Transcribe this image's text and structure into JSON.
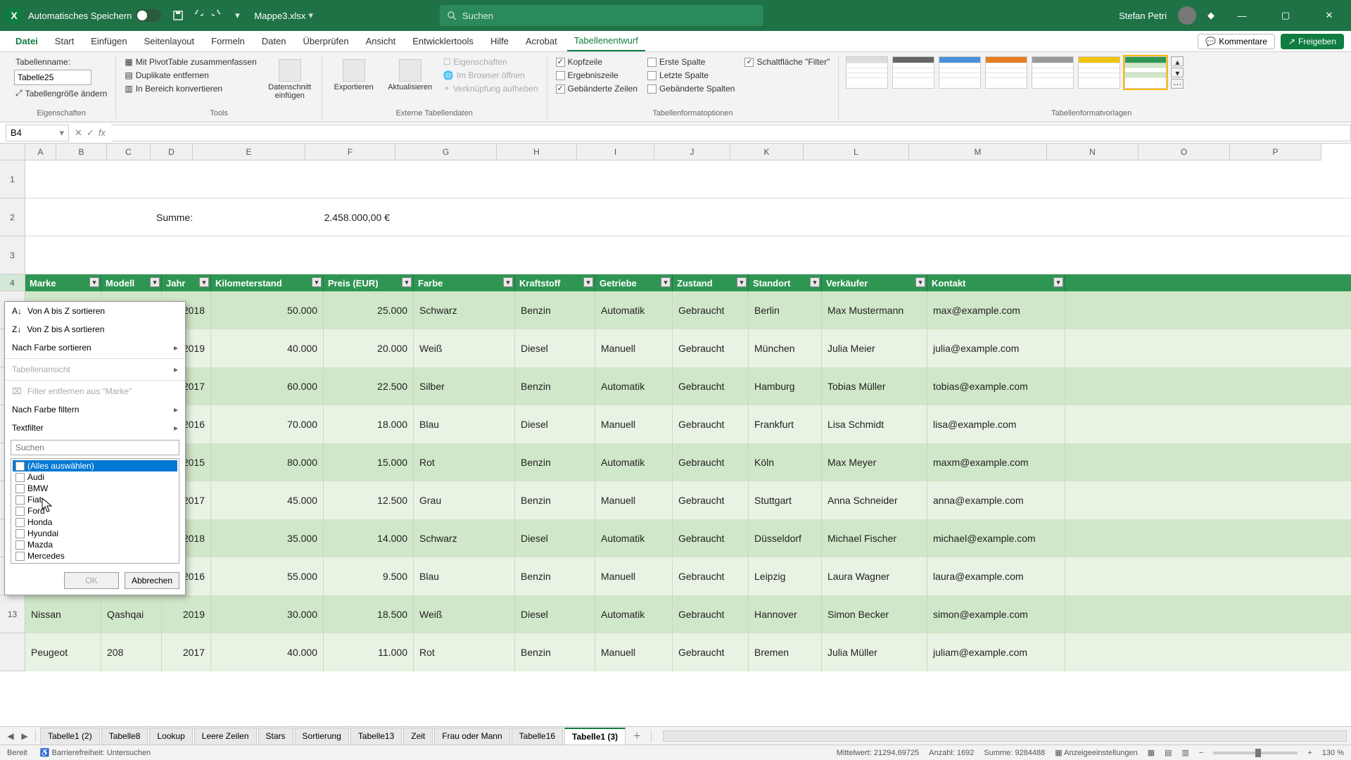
{
  "titlebar": {
    "autosave": "Automatisches Speichern",
    "filename": "Mappe3.xlsx",
    "search_placeholder": "Suchen",
    "username": "Stefan Petri"
  },
  "ribbon_tabs": [
    "Datei",
    "Start",
    "Einfügen",
    "Seitenlayout",
    "Formeln",
    "Daten",
    "Überprüfen",
    "Ansicht",
    "Entwicklertools",
    "Hilfe",
    "Acrobat",
    "Tabellenentwurf"
  ],
  "ribbon_active": "Tabellenentwurf",
  "ribbon_actions": {
    "comments": "Kommentare",
    "share": "Freigeben"
  },
  "ribbon": {
    "props": {
      "name_label": "Tabellenname:",
      "name_value": "Tabelle25",
      "resize": "Tabellengröße ändern",
      "group": "Eigenschaften"
    },
    "tools": {
      "pivot": "Mit PivotTable zusammenfassen",
      "dupes": "Duplikate entfernen",
      "range": "In Bereich konvertieren",
      "slicer": "Datenschnitt einfügen",
      "group": "Tools"
    },
    "ext": {
      "export": "Exportieren",
      "refresh": "Aktualisieren",
      "props": "Eigenschaften",
      "browser": "Im Browser öffnen",
      "unlink": "Verknüpfung aufheben",
      "group": "Externe Tabellendaten"
    },
    "opts": {
      "header": "Kopfzeile",
      "total": "Ergebniszeile",
      "banded_r": "Gebänderte Zeilen",
      "first": "Erste Spalte",
      "last": "Letzte Spalte",
      "banded_c": "Gebänderte Spalten",
      "filter": "Schaltfläche \"Filter\"",
      "group": "Tabellenformatoptionen"
    },
    "styles_group": "Tabellenformatvorlagen"
  },
  "name_box": "B4",
  "columns": [
    "A",
    "B",
    "C",
    "D",
    "E",
    "F",
    "G",
    "H",
    "I",
    "J",
    "K",
    "L",
    "M",
    "N",
    "O",
    "P"
  ],
  "sum_label": "Summe:",
  "sum_value": "2.458.000,00 €",
  "headers": [
    "Marke",
    "Modell",
    "Jahr",
    "Kilometerstand",
    "Preis (EUR)",
    "Farbe",
    "Kraftstoff",
    "Getriebe",
    "Zustand",
    "Standort",
    "Verkäufer",
    "Kontakt"
  ],
  "rows": [
    {
      "marke": "",
      "modell": "",
      "jahr": "2018",
      "km": "50.000",
      "preis": "25.000",
      "farbe": "Schwarz",
      "kraft": "Benzin",
      "getr": "Automatik",
      "zust": "Gebraucht",
      "ort": "Berlin",
      "verk": "Max Mustermann",
      "kontakt": "max@example.com"
    },
    {
      "marke": "",
      "modell": "",
      "jahr": "2019",
      "km": "40.000",
      "preis": "20.000",
      "farbe": "Weiß",
      "kraft": "Diesel",
      "getr": "Manuell",
      "zust": "Gebraucht",
      "ort": "München",
      "verk": "Julia Meier",
      "kontakt": "julia@example.com"
    },
    {
      "marke": "",
      "modell": "",
      "jahr": "2017",
      "km": "60.000",
      "preis": "22.500",
      "farbe": "Silber",
      "kraft": "Benzin",
      "getr": "Automatik",
      "zust": "Gebraucht",
      "ort": "Hamburg",
      "verk": "Tobias Müller",
      "kontakt": "tobias@example.com"
    },
    {
      "marke": "",
      "modell": "",
      "jahr": "2016",
      "km": "70.000",
      "preis": "18.000",
      "farbe": "Blau",
      "kraft": "Diesel",
      "getr": "Manuell",
      "zust": "Gebraucht",
      "ort": "Frankfurt",
      "verk": "Lisa Schmidt",
      "kontakt": "lisa@example.com"
    },
    {
      "marke": "",
      "modell": "",
      "jahr": "2015",
      "km": "80.000",
      "preis": "15.000",
      "farbe": "Rot",
      "kraft": "Benzin",
      "getr": "Automatik",
      "zust": "Gebraucht",
      "ort": "Köln",
      "verk": "Max Meyer",
      "kontakt": "maxm@example.com"
    },
    {
      "marke": "",
      "modell": "",
      "jahr": "2017",
      "km": "45.000",
      "preis": "12.500",
      "farbe": "Grau",
      "kraft": "Benzin",
      "getr": "Manuell",
      "zust": "Gebraucht",
      "ort": "Stuttgart",
      "verk": "Anna Schneider",
      "kontakt": "anna@example.com"
    },
    {
      "marke": "",
      "modell": "",
      "jahr": "2018",
      "km": "35.000",
      "preis": "14.000",
      "farbe": "Schwarz",
      "kraft": "Diesel",
      "getr": "Automatik",
      "zust": "Gebraucht",
      "ort": "Düsseldorf",
      "verk": "Michael Fischer",
      "kontakt": "michael@example.com"
    },
    {
      "marke": "",
      "modell": "",
      "jahr": "2016",
      "km": "55.000",
      "preis": "9.500",
      "farbe": "Blau",
      "kraft": "Benzin",
      "getr": "Manuell",
      "zust": "Gebraucht",
      "ort": "Leipzig",
      "verk": "Laura Wagner",
      "kontakt": "laura@example.com"
    },
    {
      "marke": "Nissan",
      "modell": "Qashqai",
      "jahr": "2019",
      "km": "30.000",
      "preis": "18.500",
      "farbe": "Weiß",
      "kraft": "Diesel",
      "getr": "Automatik",
      "zust": "Gebraucht",
      "ort": "Hannover",
      "verk": "Simon Becker",
      "kontakt": "simon@example.com"
    },
    {
      "marke": "Peugeot",
      "modell": "208",
      "jahr": "2017",
      "km": "40.000",
      "preis": "11.000",
      "farbe": "Rot",
      "kraft": "Benzin",
      "getr": "Manuell",
      "zust": "Gebraucht",
      "ort": "Bremen",
      "verk": "Julia Müller",
      "kontakt": "juliam@example.com"
    }
  ],
  "row_nums_visible": [
    "1",
    "2",
    "3",
    "4",
    "",
    "",
    "",
    "",
    "",
    "",
    "",
    "",
    "13",
    ""
  ],
  "filter": {
    "sort_az": "Von A bis Z sortieren",
    "sort_za": "Von Z bis A sortieren",
    "sort_color": "Nach Farbe sortieren",
    "sheet_view": "Tabellenansicht",
    "clear": "Filter entfernen aus \"Marke\"",
    "filter_color": "Nach Farbe filtern",
    "text_filter": "Textfilter",
    "search": "Suchen",
    "select_all": "(Alles auswählen)",
    "items": [
      "Audi",
      "BMW",
      "Fiat",
      "Ford",
      "Honda",
      "Hyundai",
      "Mazda",
      "Mercedes"
    ],
    "ok": "OK",
    "cancel": "Abbrechen"
  },
  "sheets": [
    "Tabelle1 (2)",
    "Tabelle8",
    "Lookup",
    "Leere Zeilen",
    "Stars",
    "Sortierung",
    "Tabelle13",
    "Zeit",
    "Frau oder Mann",
    "Tabelle16",
    "Tabelle1 (3)"
  ],
  "sheet_active": "Tabelle1 (3)",
  "status": {
    "ready": "Bereit",
    "access": "Barrierefreiheit: Untersuchen",
    "avg_label": "Mittelwert:",
    "avg": "21294,69725",
    "count_label": "Anzahl:",
    "count": "1692",
    "sum_label": "Summe:",
    "sum": "9284488",
    "display": "Anzeigeeinstellungen",
    "zoom": "130 %"
  }
}
